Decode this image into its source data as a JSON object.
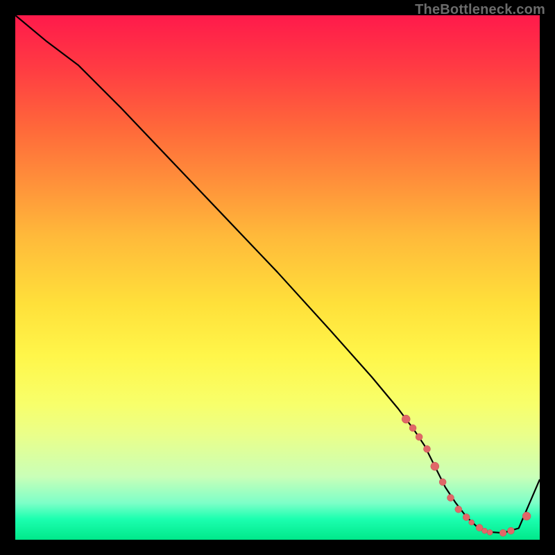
{
  "watermark": "TheBottleneck.com",
  "chart_data": {
    "type": "line",
    "title": "",
    "xlabel": "",
    "ylabel": "",
    "xlim": [
      0,
      100
    ],
    "ylim": [
      0,
      100
    ],
    "grid": false,
    "series": [
      {
        "name": "curve",
        "x": [
          0,
          6,
          12,
          20,
          30,
          40,
          50,
          60,
          68,
          73,
          76,
          78,
          80,
          82,
          84,
          86,
          88,
          90,
          93,
          96,
          100
        ],
        "y": [
          100,
          95,
          90.5,
          82.5,
          72,
          61.5,
          51,
          40,
          31,
          25,
          21,
          18,
          14,
          10,
          7,
          4.4,
          2.5,
          1.5,
          1.3,
          2.2,
          11.5
        ]
      }
    ],
    "points": {
      "name": "highlight-dots",
      "x": [
        74.5,
        75.8,
        77.0,
        78.5,
        80.0,
        81.5,
        83.0,
        84.5,
        86.0,
        87.0,
        88.5,
        89.5,
        90.5,
        93.0,
        94.5,
        97.5
      ],
      "y": [
        23.0,
        21.3,
        19.6,
        17.3,
        14.0,
        11.0,
        8.0,
        5.8,
        4.3,
        3.3,
        2.3,
        1.7,
        1.4,
        1.3,
        1.7,
        4.5
      ],
      "r": [
        6,
        5,
        5,
        5,
        6,
        5,
        5,
        5,
        5,
        4,
        5,
        4,
        4,
        5,
        5,
        6
      ]
    }
  }
}
